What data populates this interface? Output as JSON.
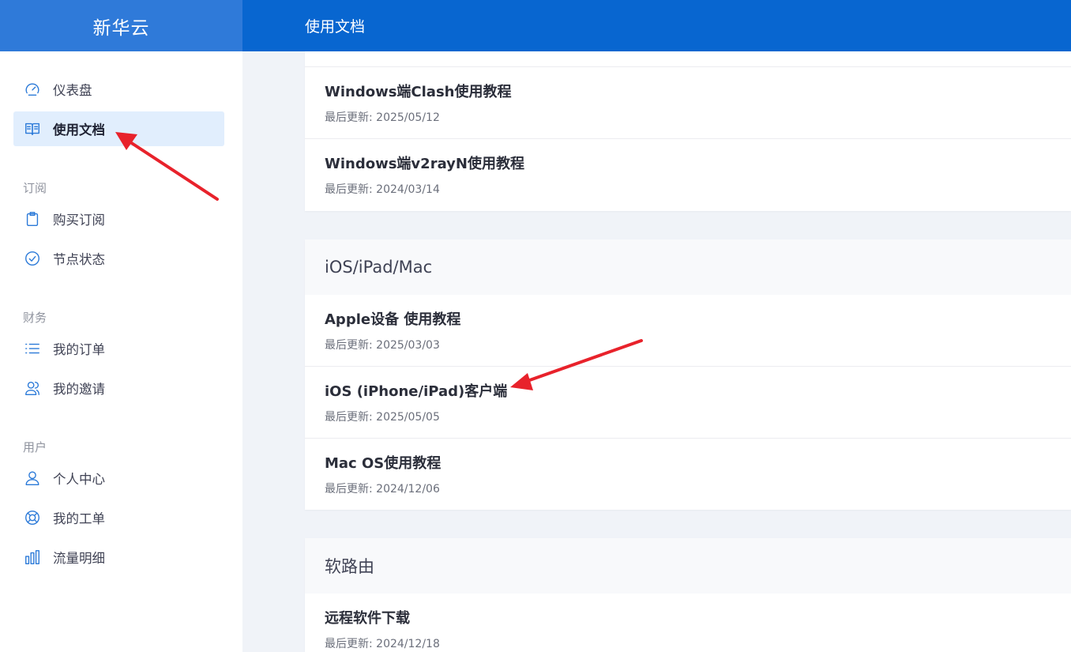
{
  "brand": {
    "name": "新华云"
  },
  "header": {
    "title": "使用文档"
  },
  "sidebar": {
    "items": [
      {
        "label": "仪表盘",
        "icon": "dashboard-icon",
        "active": false
      },
      {
        "label": "使用文档",
        "icon": "book-icon",
        "active": true
      }
    ],
    "sections": [
      {
        "title": "订阅",
        "items": [
          {
            "label": "购买订阅",
            "icon": "clipboard-icon"
          },
          {
            "label": "节点状态",
            "icon": "check-circle-icon"
          }
        ]
      },
      {
        "title": "财务",
        "items": [
          {
            "label": "我的订单",
            "icon": "list-icon"
          },
          {
            "label": "我的邀请",
            "icon": "users-icon"
          }
        ]
      },
      {
        "title": "用户",
        "items": [
          {
            "label": "个人中心",
            "icon": "user-icon"
          },
          {
            "label": "我的工单",
            "icon": "lifebuoy-icon"
          },
          {
            "label": "流量明细",
            "icon": "bar-chart-icon"
          }
        ]
      }
    ]
  },
  "docs": {
    "windows": [
      {
        "title": "Windows端Clash使用教程",
        "date": "最后更新: 2025/05/12"
      },
      {
        "title": "Windows端v2rayN使用教程",
        "date": "最后更新: 2024/03/14"
      }
    ],
    "apple": {
      "header": "iOS/iPad/Mac",
      "items": [
        {
          "title": "Apple设备 使用教程",
          "date": "最后更新: 2025/03/03"
        },
        {
          "title": "iOS (iPhone/iPad)客户端",
          "date": "最后更新: 2025/05/05"
        },
        {
          "title": "Mac OS使用教程",
          "date": "最后更新: 2024/12/06"
        }
      ]
    },
    "router": {
      "header": "软路由",
      "items": [
        {
          "title": "远程软件下载",
          "date": "最后更新: 2024/12/18"
        }
      ]
    }
  },
  "colors": {
    "header": "#0866d0",
    "brand": "#2f7ad9",
    "accent": "#2a79d8",
    "arrow": "#e8222b"
  }
}
